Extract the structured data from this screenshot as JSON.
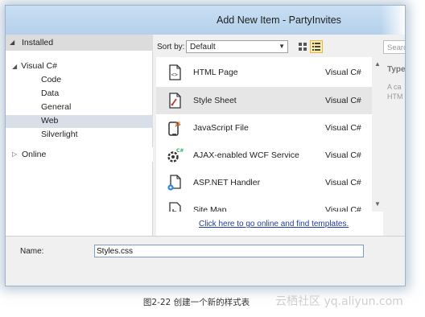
{
  "window": {
    "title": "Add New Item - PartyInvites"
  },
  "left_panel": {
    "installed_label": "Installed",
    "tree": [
      {
        "label": "Visual C#",
        "expanded": true
      },
      {
        "label": "Code"
      },
      {
        "label": "Data"
      },
      {
        "label": "General"
      },
      {
        "label": "Web",
        "selected": true
      },
      {
        "label": "Silverlight"
      }
    ],
    "online_label": "Online"
  },
  "toolbar": {
    "sort_label": "Sort by:",
    "sort_value": "Default",
    "search_placeholder": "Search"
  },
  "items": [
    {
      "name": "HTML Page",
      "lang": "Visual C#",
      "icon": "html-page-icon"
    },
    {
      "name": "Style Sheet",
      "lang": "Visual C#",
      "icon": "style-sheet-icon",
      "selected": true
    },
    {
      "name": "JavaScript File",
      "lang": "Visual C#",
      "icon": "javascript-file-icon"
    },
    {
      "name": "AJAX-enabled WCF Service",
      "lang": "Visual C#",
      "icon": "wcf-service-icon"
    },
    {
      "name": "ASP.NET Handler",
      "lang": "Visual C#",
      "icon": "handler-icon"
    },
    {
      "name": "Site Map",
      "lang": "Visual C#",
      "icon": "site-map-icon"
    }
  ],
  "online_link": "Click here to go online and find templates.",
  "right_panel": {
    "type_label": "Type",
    "desc_line1": "A ca",
    "desc_line2": "HTM"
  },
  "bottom": {
    "name_label": "Name:",
    "name_value": "Styles.css"
  },
  "caption": "图2-22 创建一个新的样式表",
  "watermark": "云栖社区 yq.aliyun.com",
  "colors": {
    "title_bar": "#c4dcf2",
    "link": "#1f3e9c",
    "selected_row": "#e6e6e6",
    "tree_selected": "#d8dfe8"
  }
}
